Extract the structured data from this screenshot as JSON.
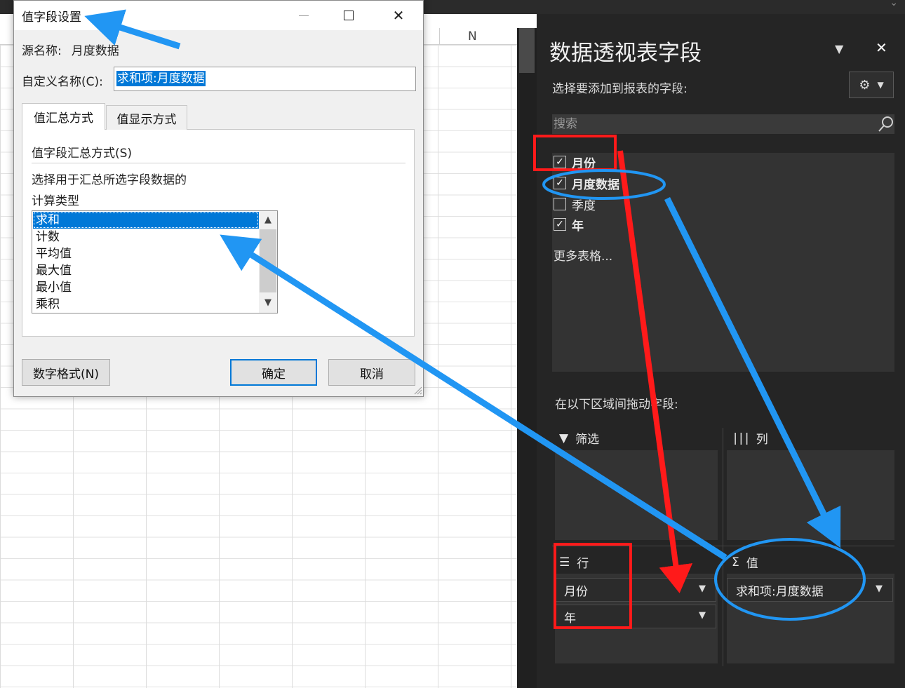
{
  "sheet": {
    "column_letter": "N"
  },
  "pane": {
    "title": "数据透视表字段",
    "subtitle": "选择要添加到报表的字段:",
    "search_placeholder": "搜索",
    "fields": [
      {
        "label": "月份",
        "checked": true,
        "bold": true
      },
      {
        "label": "月度数据",
        "checked": true,
        "bold": true
      },
      {
        "label": "季度",
        "checked": false,
        "bold": false
      },
      {
        "label": "年",
        "checked": true,
        "bold": true
      }
    ],
    "more_tables": "更多表格...",
    "drag_label": "在以下区域间拖动字段:",
    "areas": {
      "filter_label": "筛选",
      "columns_label": "列",
      "rows_label": "行",
      "values_label": "值",
      "rows_items": [
        "月份",
        "年"
      ],
      "values_items": [
        "求和项:月度数据"
      ]
    }
  },
  "dialog": {
    "title": "值字段设置",
    "source_label": "源名称:",
    "source_value": "月度数据",
    "custom_name_label": "自定义名称(C):",
    "custom_name_value": "求和项:月度数据",
    "tabs": [
      "值汇总方式",
      "值显示方式"
    ],
    "section_label": "值字段汇总方式(S)",
    "desc_line1": "选择用于汇总所选字段数据的",
    "desc_line2": "计算类型",
    "options": [
      "求和",
      "计数",
      "平均值",
      "最大值",
      "最小值",
      "乘积"
    ],
    "selected_option": "求和",
    "number_format_button": "数字格式(N)",
    "ok_button": "确定",
    "cancel_button": "取消"
  },
  "colors": {
    "pane_bg": "#252525",
    "selection_blue": "#0078d7",
    "annotation_red": "#ff1a1a",
    "annotation_blue": "#2196f3"
  }
}
